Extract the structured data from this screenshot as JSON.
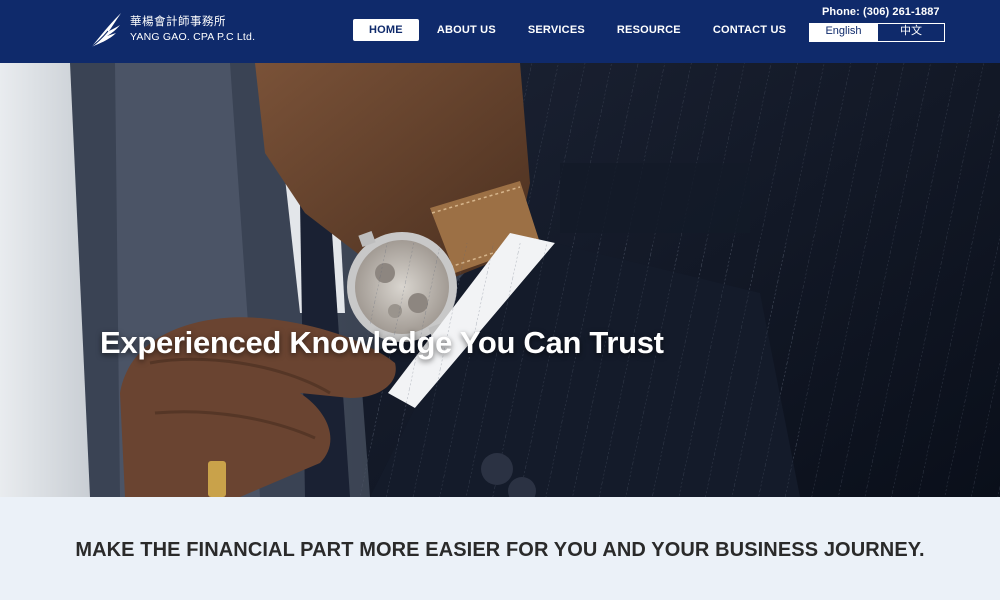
{
  "header": {
    "logo_cn": "華楊會計師事務所",
    "logo_en": "YANG GAO. CPA P.C Ltd.",
    "logo_icon": "wing-icon",
    "phone": "Phone: (306) 261-1887",
    "background_color": "#0f2a6b"
  },
  "nav": {
    "items": [
      {
        "label": "HOME",
        "active": true
      },
      {
        "label": "ABOUT US",
        "active": false
      },
      {
        "label": "SERVICES",
        "active": false
      },
      {
        "label": "RESOURCE",
        "active": false
      },
      {
        "label": "CONTACT US",
        "active": false
      }
    ]
  },
  "language": {
    "options": [
      "English",
      "中文"
    ],
    "selected": "English"
  },
  "hero": {
    "title": "Experienced Knowledge You Can Trust"
  },
  "band": {
    "tagline": "MAKE THE FINANCIAL PART MORE EASIER FOR YOU AND YOUR BUSINESS JOURNEY.",
    "background_color": "#ebf1f8"
  }
}
